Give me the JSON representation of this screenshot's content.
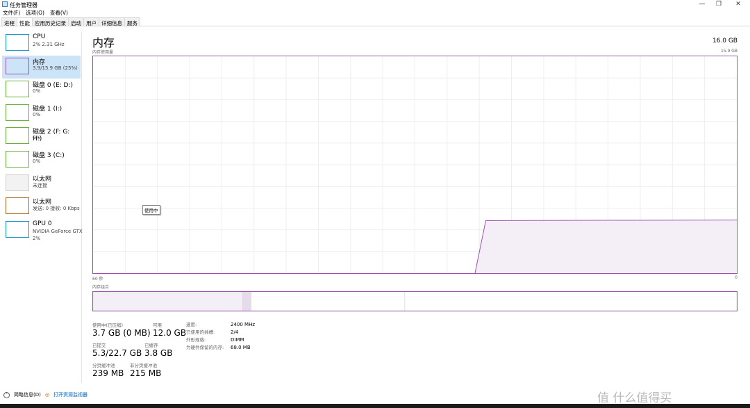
{
  "window": {
    "title": "任务管理器",
    "minimize": "—",
    "restore": "❐",
    "close": "✕"
  },
  "menu": [
    "文件(F)",
    "选项(O)",
    "查看(V)"
  ],
  "tabs": [
    {
      "label": "进程"
    },
    {
      "label": "性能",
      "active": true
    },
    {
      "label": "应用历史记录"
    },
    {
      "label": "启动"
    },
    {
      "label": "用户"
    },
    {
      "label": "详细信息"
    },
    {
      "label": "服务"
    }
  ],
  "sidebar": [
    {
      "name": "CPU",
      "sub": "2% 2.31 GHz",
      "color": "#1795c8"
    },
    {
      "name": "内存",
      "sub": "3.9/15.9 GB (25%)",
      "color": "#9b4fb0",
      "selected": true
    },
    {
      "name": "磁盘 0 (E: D:)",
      "sub": "0%",
      "color": "#6aae3a"
    },
    {
      "name": "磁盘 1 (I:)",
      "sub": "0%",
      "color": "#6aae3a"
    },
    {
      "name": "磁盘 2 (F: G: H:)",
      "sub": "0%",
      "color": "#6aae3a"
    },
    {
      "name": "磁盘 3 (C:)",
      "sub": "0%",
      "color": "#6aae3a"
    },
    {
      "name": "以太网",
      "sub": "未连接",
      "color": "#cccccc"
    },
    {
      "name": "以太网",
      "sub": "发送: 0 接收: 0 Kbps",
      "color": "#a7681e"
    },
    {
      "name": "GPU 0",
      "sub": "NVIDIA GeForce GTX",
      "sub2": "2%",
      "color": "#1795c8"
    }
  ],
  "main": {
    "title": "内存",
    "total": "16.0 GB",
    "usage_label": "内存使用量",
    "usage_max": "15.9 GB",
    "time_left": "60 秒",
    "time_right": "0",
    "composition_label": "内存组合",
    "tooltip": "使用中",
    "accent": "#9b4fb0",
    "usage_history": [
      {
        "seconds_ago": 24.4,
        "gb": 0
      },
      {
        "seconds_ago": 23.4,
        "gb": 3.85
      },
      {
        "seconds_ago": 0,
        "gb": 3.9
      }
    ],
    "composition_gb": {
      "in_use": 3.7,
      "modified": 0.2,
      "standby": 3.8,
      "free": 8.2
    }
  },
  "stats": {
    "in_use_label": "使用中(已压缩)",
    "in_use": "3.7 GB (0 MB)",
    "available_label": "可用",
    "available": "12.0 GB",
    "committed_label": "已提交",
    "committed": "5.3/22.7 GB",
    "cached_label": "已缓存",
    "cached": "3.8 GB",
    "paged_label": "分页缓冲池",
    "paged": "239 MB",
    "nonpaged_label": "非分页缓冲池",
    "nonpaged": "215 MB",
    "speed_label": "速度:",
    "speed": "2400 MHz",
    "slots_label": "已使用的插槽:",
    "slots": "2/4",
    "form_label": "外形规格:",
    "form": "DIMM",
    "reserved_label": "为硬件保留的内存:",
    "reserved": "68.0 MB"
  },
  "footer": {
    "summary": "简略信息(D)",
    "monitor": "打开资源监视器"
  },
  "watermark": "值 什么值得买"
}
